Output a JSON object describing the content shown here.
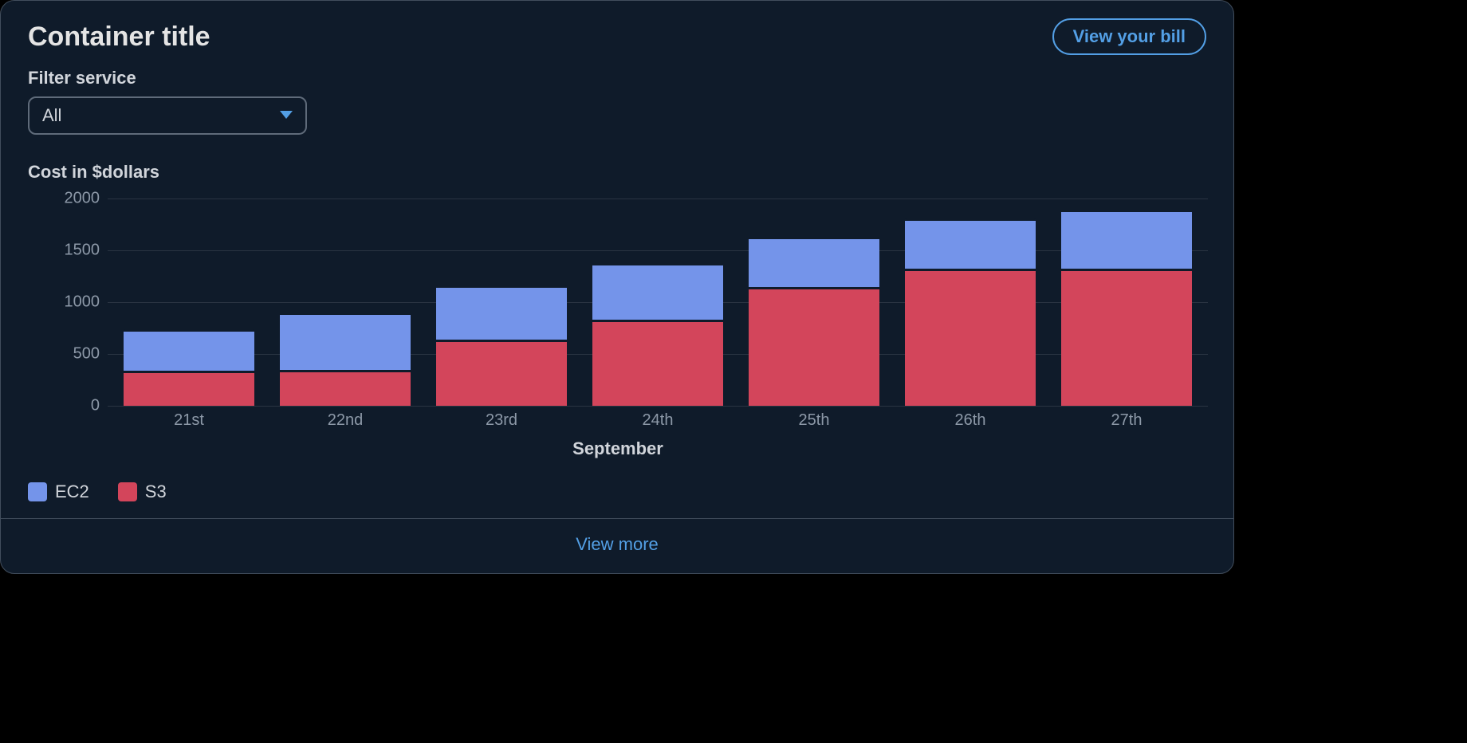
{
  "header": {
    "title": "Container title",
    "view_bill_label": "View your bill"
  },
  "filter": {
    "label": "Filter service",
    "selected": "All"
  },
  "chart_title": "Cost in $dollars",
  "colors": {
    "ec2": "#7494ea",
    "s3": "#d3455b"
  },
  "legend": {
    "ec2": "EC2",
    "s3": "S3"
  },
  "footer": {
    "view_more": "View more"
  },
  "chart_data": {
    "type": "bar",
    "stacked": true,
    "xlabel": "September",
    "ylabel": "",
    "ylim": [
      0,
      2000
    ],
    "yticks": [
      0,
      500,
      1000,
      1500,
      2000
    ],
    "categories": [
      "21st",
      "22nd",
      "23rd",
      "24th",
      "25th",
      "26th",
      "27th"
    ],
    "series": [
      {
        "name": "S3",
        "values": [
          340,
          350,
          640,
          830,
          1150,
          1320,
          1320
        ]
      },
      {
        "name": "EC2",
        "values": [
          400,
          550,
          520,
          550,
          480,
          490,
          570
        ]
      }
    ]
  }
}
